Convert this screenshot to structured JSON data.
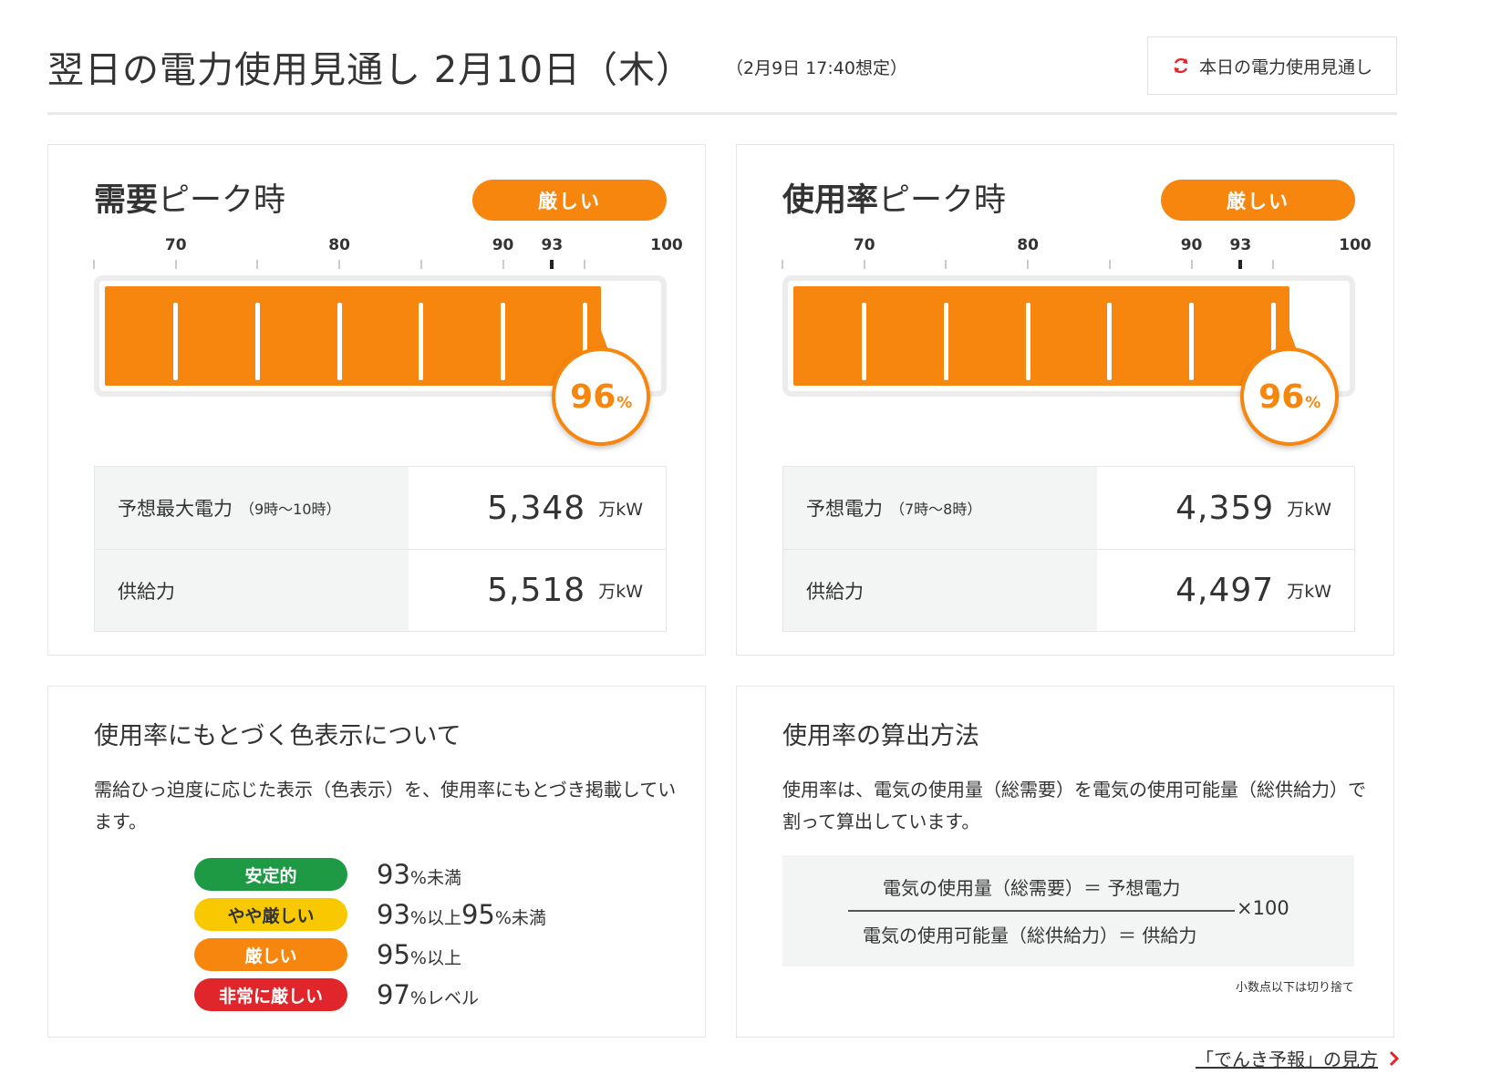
{
  "header": {
    "title": "翌日の電力使用見通し 2月10日（木）",
    "subtitle": "（2月9日 17:40想定）",
    "today_button_label": "本日の電力使用見通し"
  },
  "colors": {
    "accent_orange": "#f7860f",
    "stable_green": "#1e9a45",
    "slightly_tight_yellow": "#f8c900",
    "tight_orange": "#f7860f",
    "very_tight_red": "#e0262a",
    "link_chevron_red": "#e0262a"
  },
  "icons": {
    "today_button": "refresh-icon",
    "guide_link": "chevron-right-icon"
  },
  "gauge_scale": {
    "labels": [
      "70",
      "80",
      "90",
      "93",
      "100"
    ]
  },
  "demand_peak": {
    "heading_bold": "需要",
    "heading_rest": "ピーク時",
    "status": "厳しい",
    "usage_rate_percent": 96,
    "value": "96",
    "unit": "%",
    "rows": [
      {
        "label": "予想最大電力",
        "sub": "（9時～10時）",
        "value": "5,348",
        "unit": "万kW"
      },
      {
        "label": "供給力",
        "sub": "",
        "value": "5,518",
        "unit": "万kW"
      }
    ]
  },
  "usage_peak": {
    "heading_bold": "使用率",
    "heading_rest": "ピーク時",
    "status": "厳しい",
    "usage_rate_percent": 96,
    "value": "96",
    "unit": "%",
    "rows": [
      {
        "label": "予想電力",
        "sub": "（7時～8時）",
        "value": "4,359",
        "unit": "万kW"
      },
      {
        "label": "供給力",
        "sub": "",
        "value": "4,497",
        "unit": "万kW"
      }
    ]
  },
  "color_legend": {
    "title": "使用率にもとづく色表示について",
    "description": "需給ひっ迫度に応じた表示（色表示）を、使用率にもとづき掲載しています。",
    "items": [
      {
        "label": "安定的",
        "parts": [
          {
            "n": "93",
            "t": "%未満"
          }
        ]
      },
      {
        "label": "やや厳しい",
        "parts": [
          {
            "n": "93",
            "t": "%以上"
          },
          {
            "n": "95",
            "t": "%未満"
          }
        ]
      },
      {
        "label": "厳しい",
        "parts": [
          {
            "n": "95",
            "t": "%以上"
          }
        ]
      },
      {
        "label": "非常に厳しい",
        "parts": [
          {
            "n": "97",
            "t": "%レベル"
          }
        ]
      }
    ]
  },
  "calc_method": {
    "title": "使用率の算出方法",
    "description": "使用率は、電気の使用量（総需要）を電気の使用可能量（総供給力）で割って算出しています。",
    "numerator": "電気の使用量（総需要）＝ 予想電力",
    "denominator": "電気の使用可能量（総供給力）＝ 供給力",
    "multiplier": "×100",
    "note": "小数点以下は切り捨て"
  },
  "footer": {
    "guide_link": "「でんき予報」の見方"
  }
}
